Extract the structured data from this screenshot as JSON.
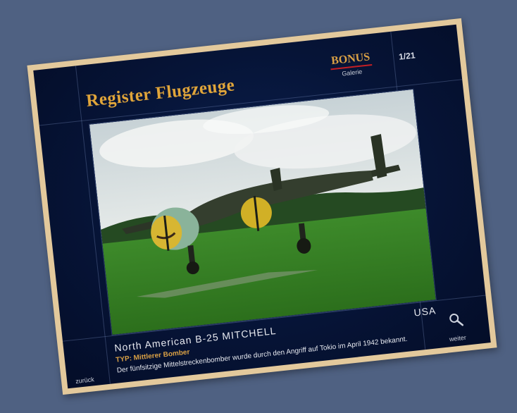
{
  "header": {
    "title": "Register Flugzeuge",
    "bonus_label": "BONUS",
    "bonus_sub": "Galerie",
    "counter": "1/21"
  },
  "photo": {
    "icon": "aircraft-photo"
  },
  "caption": {
    "name": "North American B-25 MITCHELL",
    "country": "USA",
    "type": "TYP: Mittlerer Bomber",
    "description": "Der fünfsitzige Mittelstreckenbomber wurde durch den Angriff auf Tokio im April 1942 bekannt."
  },
  "nav": {
    "back_label": "zurück",
    "next_label": "weiter",
    "zoom_icon": "magnifier-icon"
  },
  "colors": {
    "accent": "#d9a045",
    "frame": "#e3c99c",
    "background": "#4f6182",
    "bonus_underline": "#c41f24"
  }
}
